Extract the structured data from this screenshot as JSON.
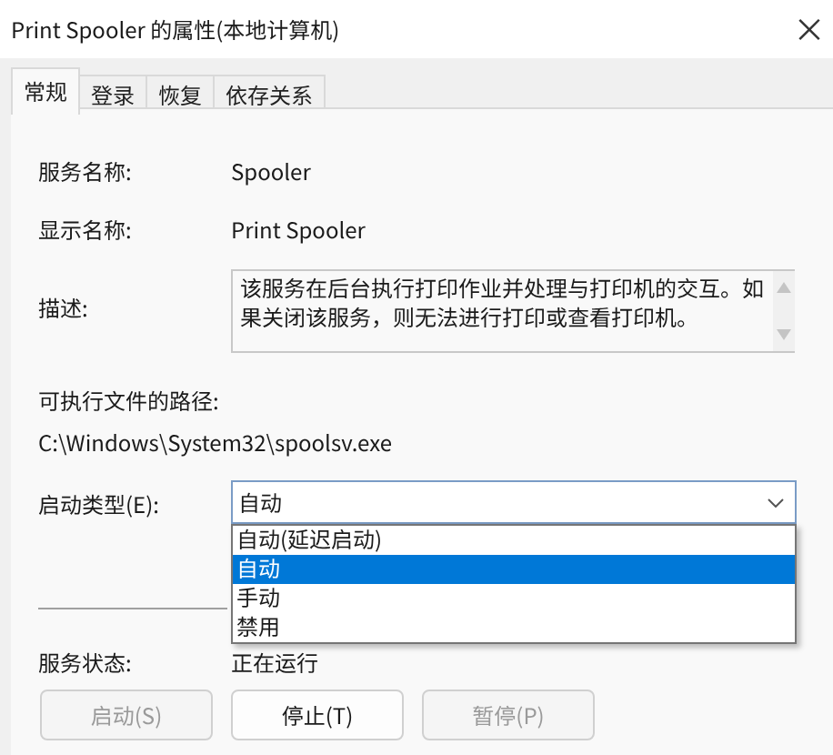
{
  "window": {
    "title": "Print Spooler 的属性(本地计算机)",
    "close": "×"
  },
  "tabs": [
    {
      "label": "常规",
      "selected": true
    },
    {
      "label": "登录",
      "selected": false
    },
    {
      "label": "恢复",
      "selected": false
    },
    {
      "label": "依存关系",
      "selected": false
    }
  ],
  "fields": [
    {
      "label": "服务名称:",
      "value": "Spooler"
    },
    {
      "label": "显示名称:",
      "value": "Print Spooler"
    }
  ],
  "description": {
    "label": "描述:",
    "text": "该服务在后台执行打印作业并处理与打印机的交互。如果关闭该服务，则无法进行打印或查看打印机。"
  },
  "path": {
    "label": "可执行文件的路径:",
    "value": "C:\\Windows\\System32\\spoolsv.exe"
  },
  "startup_type": {
    "label": "启动类型(E):",
    "value": "自动",
    "expanded": true,
    "options": [
      {
        "label": "自动(延迟启动)",
        "selected": false
      },
      {
        "label": "自动",
        "selected": true
      },
      {
        "label": "手动",
        "selected": false
      },
      {
        "label": "禁用",
        "selected": false
      }
    ]
  },
  "service_status": {
    "label": "服务状态:",
    "value": "正在运行"
  },
  "buttons": [
    {
      "label": "启动(S)",
      "disabled": true
    },
    {
      "label": "停止(T)",
      "disabled": false
    },
    {
      "label": "暂停(P)",
      "disabled": true
    }
  ]
}
